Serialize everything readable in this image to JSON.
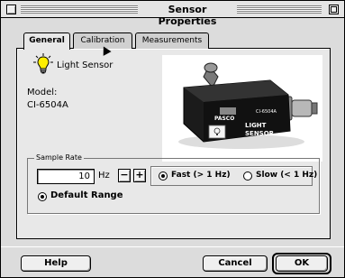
{
  "window": {
    "title": "Sensor Properties"
  },
  "tabs": [
    {
      "label": "General",
      "active": true
    },
    {
      "label": "Calibration",
      "active": false
    },
    {
      "label": "Measurements",
      "active": false
    }
  ],
  "sensor": {
    "name": "Light Sensor",
    "model_label": "Model:",
    "model_value": "CI-6504A",
    "photo_brand": "PASCO",
    "photo_model": "CI-6504A",
    "photo_text_1": "LIGHT",
    "photo_text_2": "SENSOR"
  },
  "sample_rate": {
    "group_label": "Sample Rate",
    "value": "10",
    "unit": "Hz",
    "minus_label": "−",
    "plus_label": "+",
    "fast_label": "Fast (> 1 Hz)",
    "slow_label": "Slow (< 1 Hz)",
    "selected": "fast",
    "default_range_label": "Default Range"
  },
  "buttons": {
    "help": "Help",
    "cancel": "Cancel",
    "ok": "OK"
  },
  "icons": {
    "sensor": "lightbulb-icon",
    "cursor": "arrow-cursor-icon"
  }
}
